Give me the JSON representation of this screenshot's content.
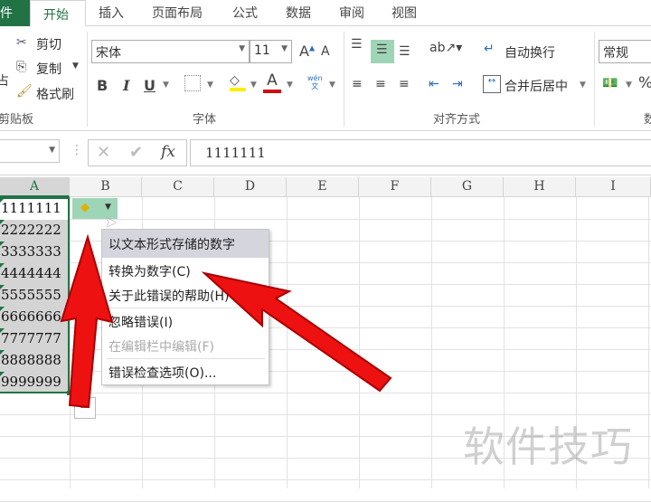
{
  "tabs": {
    "file": "件",
    "items": [
      "开始",
      "插入",
      "页面布局",
      "公式",
      "数据",
      "审阅",
      "视图"
    ]
  },
  "clipboard": {
    "paste": "占",
    "cut": "剪切",
    "copy": "复制",
    "format_painter": "格式刷",
    "group": "剪贴板"
  },
  "font": {
    "name": "宋体",
    "size": "11",
    "bold": "B",
    "italic": "I",
    "underline": "U",
    "group": "字体",
    "phonetic": "wén"
  },
  "alignment": {
    "wrap": "自动换行",
    "merge": "合并后居中",
    "group": "对齐方式"
  },
  "number": {
    "format": "常规",
    "percent": "%",
    "group": "数"
  },
  "formula_bar": {
    "fx": "fx",
    "value": "1111111"
  },
  "columns": [
    "A",
    "B",
    "C",
    "D",
    "E",
    "F",
    "G",
    "H",
    "I"
  ],
  "cells_a": [
    "1111111",
    "2222222",
    "3333333",
    "4444444",
    "5555555",
    "6666666",
    "7777777",
    "8888888",
    "9999999"
  ],
  "menu": {
    "header": "以文本形式存储的数字",
    "items": [
      {
        "label": "转换为数字(C)",
        "enabled": true
      },
      {
        "label": "关于此错误的帮助(H)",
        "enabled": true
      },
      {
        "label": "忽略错误(I)",
        "enabled": true
      },
      {
        "label": "在编辑栏中编辑(F)",
        "enabled": false
      },
      {
        "label": "错误检查选项(O)...",
        "enabled": true
      }
    ]
  },
  "watermark": "软件技巧",
  "colors": {
    "accent": "#217346",
    "arrow": "#ee1111",
    "selection": "#d4d4d4"
  }
}
